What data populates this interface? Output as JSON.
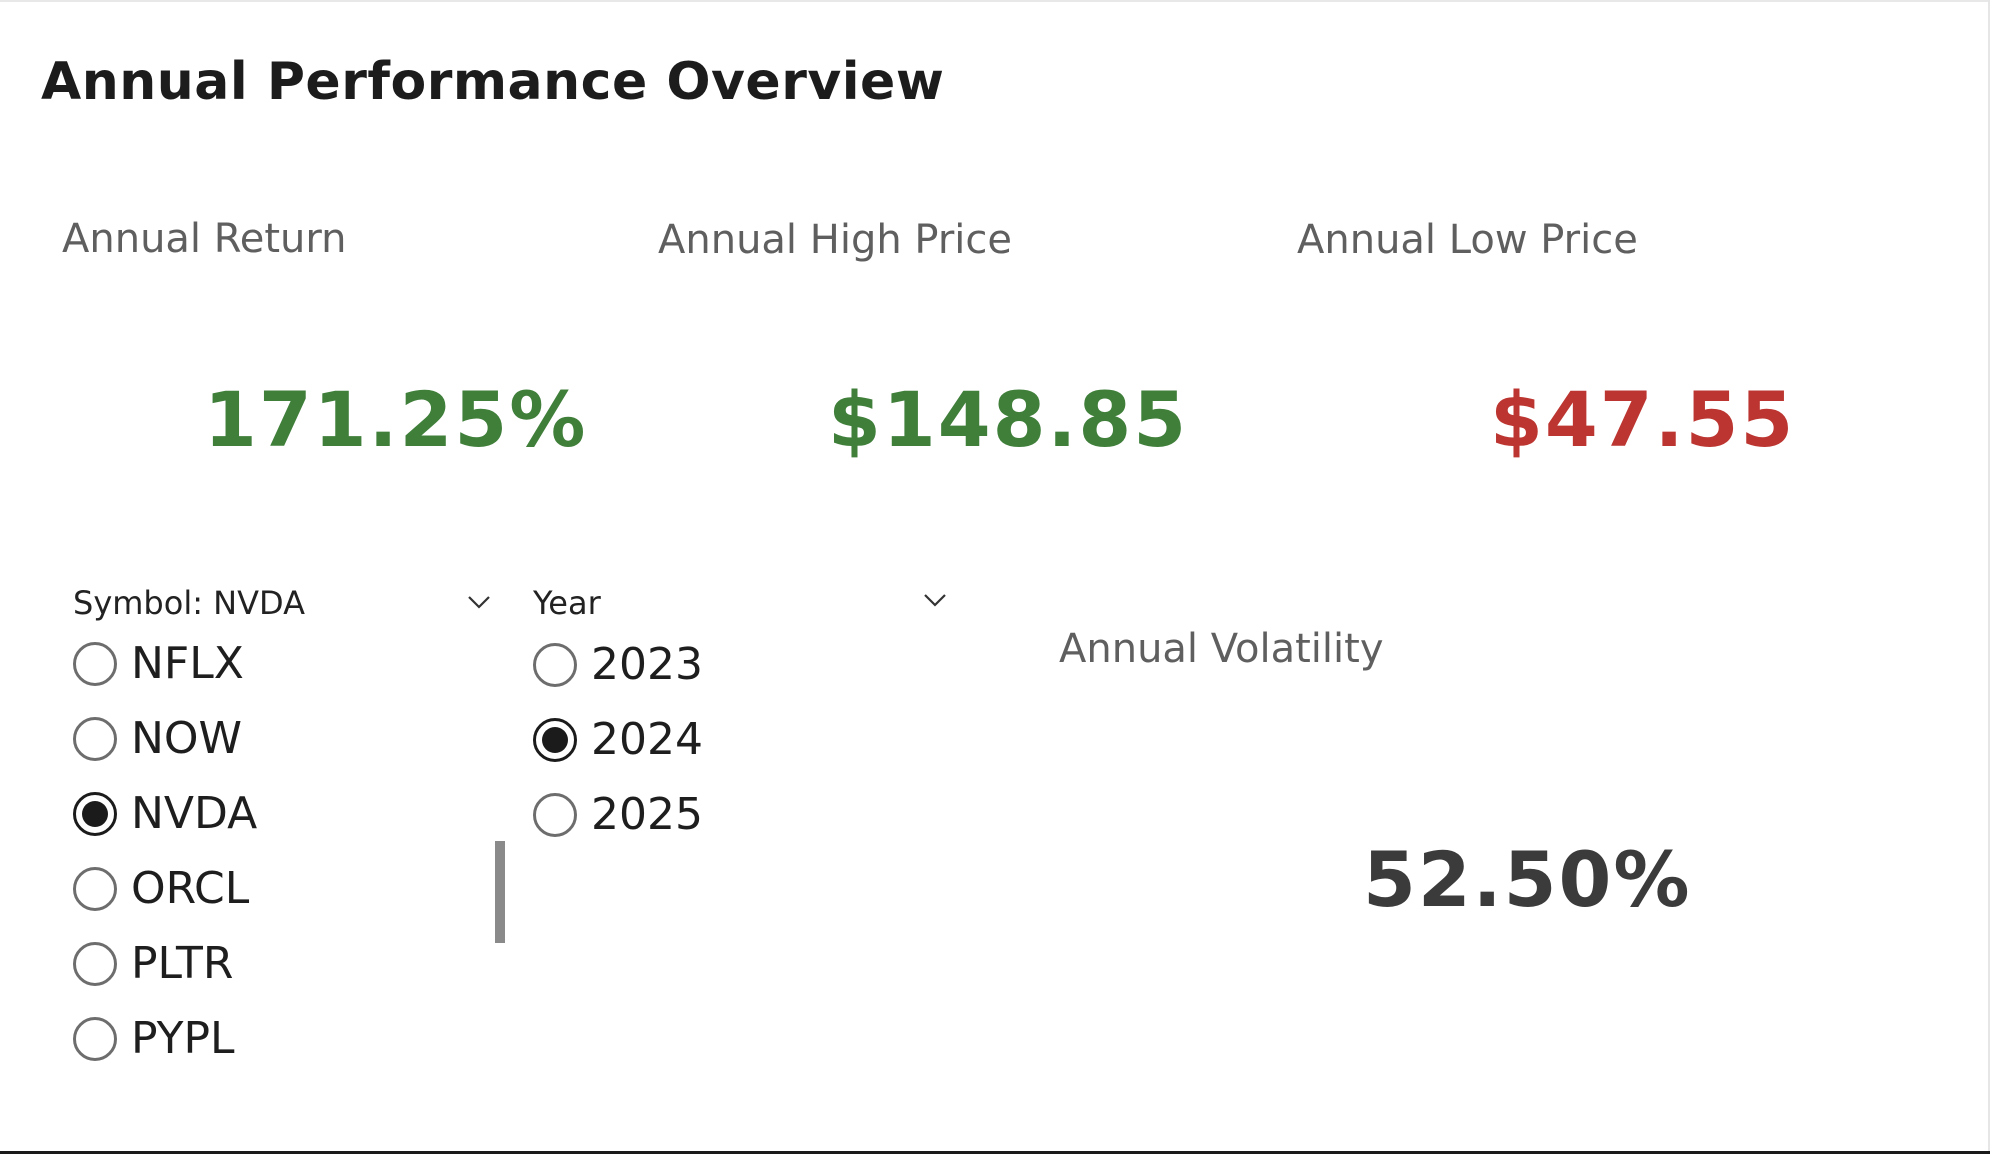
{
  "title": "Annual Performance Overview",
  "kpis": {
    "annual_return": {
      "label": "Annual Return",
      "value": "171.25%",
      "color": "#3f7f3a"
    },
    "annual_high": {
      "label": "Annual High Price",
      "value": "$148.85",
      "color": "#3f7f3a"
    },
    "annual_low": {
      "label": "Annual Low Price",
      "value": "$47.55",
      "color": "#bc3530"
    },
    "annual_volatility": {
      "label": "Annual Volatility",
      "value": "52.50%",
      "color": "#3b3b3b"
    }
  },
  "symbol_slicer": {
    "header": "Symbol: NVDA",
    "selected": "NVDA",
    "options": [
      {
        "label": "NFLX",
        "checked": false
      },
      {
        "label": "NOW",
        "checked": false
      },
      {
        "label": "NVDA",
        "checked": true
      },
      {
        "label": "ORCL",
        "checked": false
      },
      {
        "label": "PLTR",
        "checked": false
      },
      {
        "label": "PYPL",
        "checked": false
      }
    ]
  },
  "year_slicer": {
    "header": "Year",
    "selected": "2024",
    "options": [
      {
        "label": "2023",
        "checked": false
      },
      {
        "label": "2024",
        "checked": true
      },
      {
        "label": "2025",
        "checked": false
      }
    ]
  },
  "icons": {
    "dropdown": "chevron-down-icon",
    "radio": "radio-button-icon"
  }
}
